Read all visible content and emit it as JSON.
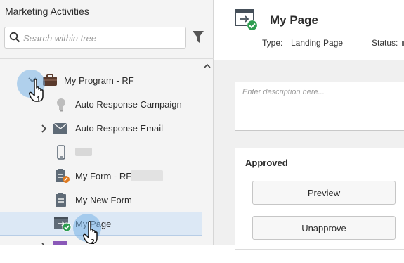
{
  "left_panel": {
    "title": "Marketing Activities",
    "search": {
      "placeholder": "Search within tree",
      "value": ""
    },
    "tree": [
      {
        "label": "My Program - RF",
        "icon": "briefcase-icon",
        "expanded": true
      },
      {
        "label": "Auto Response Campaign",
        "icon": "lightbulb-icon"
      },
      {
        "label": "Auto Response Email",
        "icon": "envelope-icon",
        "expandable": true
      },
      {
        "label": "",
        "icon": "mobile-icon"
      },
      {
        "label": "My Form - RF",
        "icon": "form-approved-icon"
      },
      {
        "label": "My New Form",
        "icon": "form-icon"
      },
      {
        "label": "My Page",
        "icon": "landing-page-approved-icon",
        "selected": true
      }
    ],
    "cursor_steps": [
      "1",
      "2"
    ]
  },
  "right_panel": {
    "page_title": "My Page",
    "type_label": "Type:",
    "type_value": "Landing Page",
    "status_label": "Status:",
    "description_placeholder": "Enter description here...",
    "approval": {
      "status": "Approved",
      "preview_label": "Preview",
      "unapprove_label": "Unapprove"
    }
  },
  "colors": {
    "selected_row": "#dce8f5",
    "approved_green": "#2d9d4f",
    "icon_gray": "#5f6b77",
    "callout_blue": "#78b2e6"
  }
}
